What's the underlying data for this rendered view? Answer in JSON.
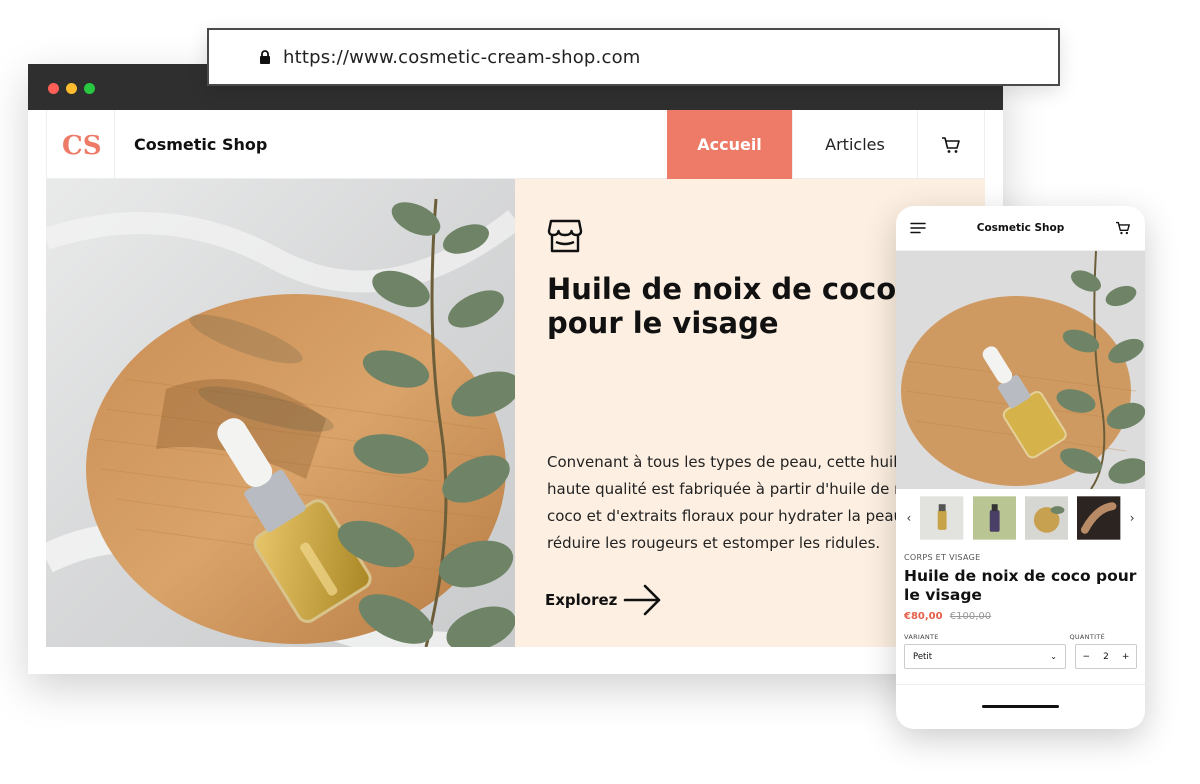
{
  "browser": {
    "url": "https://www.cosmetic-cream-shop.com"
  },
  "site": {
    "logo_text": "CS",
    "brand": "Cosmetic Shop",
    "nav": [
      {
        "label": "Accueil",
        "active": true
      },
      {
        "label": "Articles",
        "active": false
      }
    ],
    "cart_icon": "cart-icon"
  },
  "hero": {
    "title": "Huile de noix de coco pour le visage",
    "description_lines": [
      "Convenant à tous les types de peau, cette huile de",
      "haute qualité est fabriquée à partir d'huile de noix de",
      "coco et d'extraits floraux pour hydrater la peau,",
      "réduire les rougeurs et estomper les ridules."
    ],
    "cta_label": "Explorez"
  },
  "mobile": {
    "brand": "Cosmetic Shop",
    "category": "CORPS ET VISAGE",
    "title": "Huile de noix de coco pour le visage",
    "price": "€80,00",
    "old_price": "€100,00",
    "variant_label": "VARIANTE",
    "variant_value": "Petit",
    "quantity_label": "QUANTITÉ",
    "quantity_value": "2",
    "minus": "−",
    "plus": "+"
  },
  "colors": {
    "accent": "#ee7b67",
    "hero_panel": "#fdf0e2",
    "browser_bar": "#2f2f2f",
    "price": "#e5604a"
  }
}
